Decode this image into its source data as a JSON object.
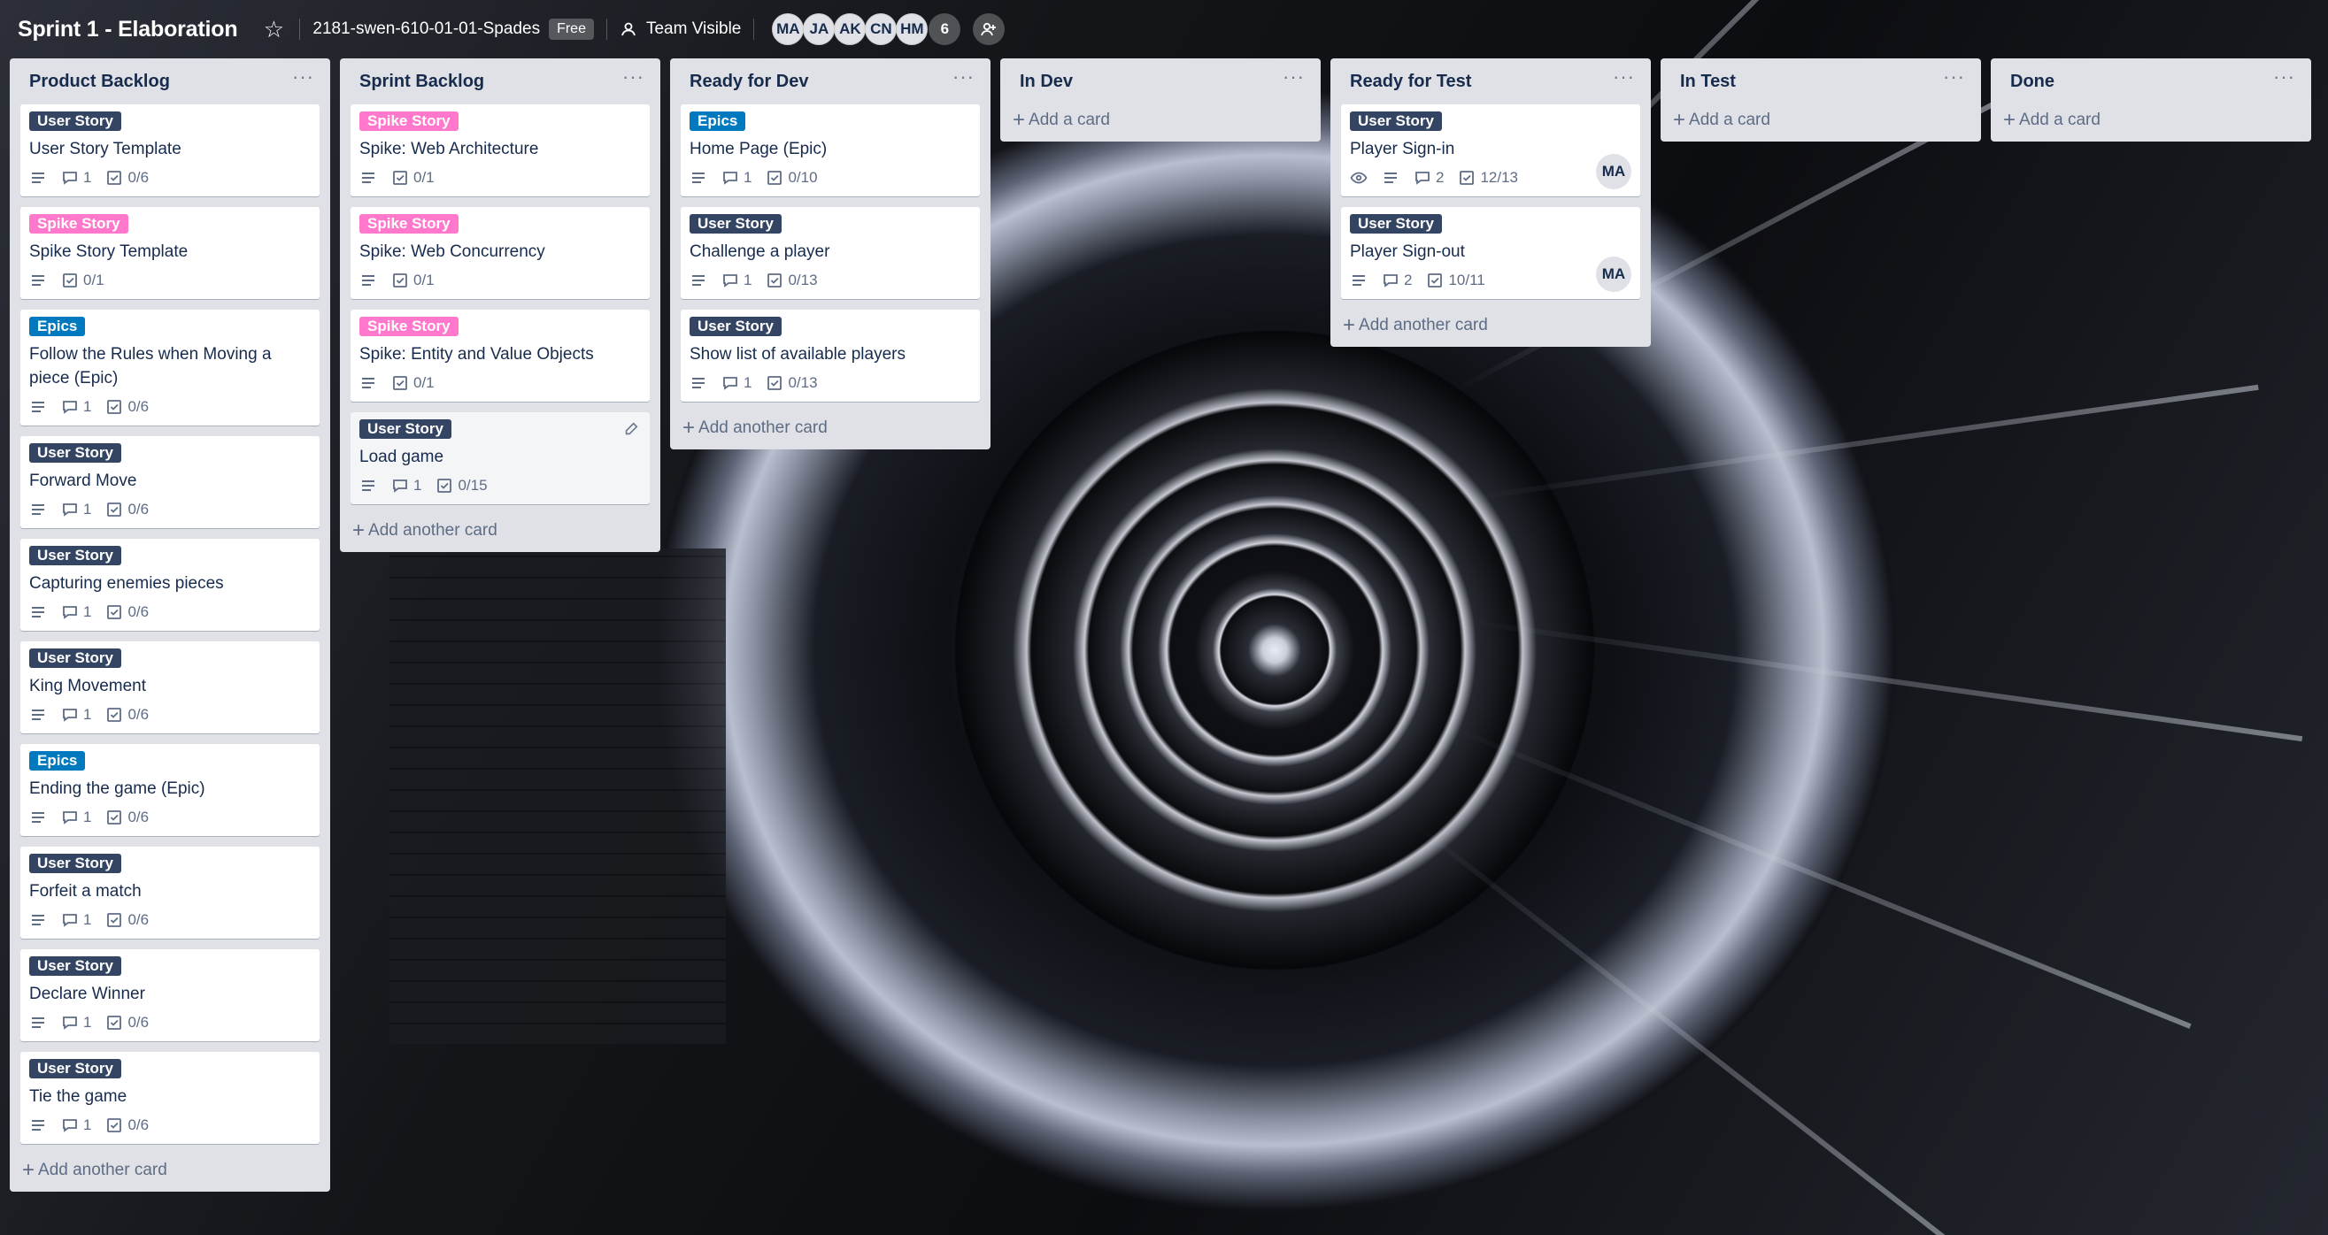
{
  "board": {
    "title": "Sprint 1 - Elaboration",
    "team": "2181-swen-610-01-01-Spades",
    "plan_badge": "Free",
    "visibility": "Team Visible",
    "members": [
      "MA",
      "JA",
      "AK",
      "CN",
      "HM"
    ],
    "more_members": "6"
  },
  "colors": {
    "user_story": "#344563",
    "spike_story": "#ff78cb",
    "epics": "#0079bf",
    "list_bg": "#dfe1e6"
  },
  "lists": [
    {
      "title": "Product Backlog",
      "add_label": "Add another card",
      "cards": [
        {
          "label": "User Story",
          "title": "User Story Template",
          "comments": "1",
          "checklist": "0/6"
        },
        {
          "label": "Spike Story",
          "title": "Spike Story Template",
          "checklist": "0/1"
        },
        {
          "label": "Epics",
          "title": "Follow the Rules when Moving a piece (Epic)",
          "comments": "1",
          "checklist": "0/6"
        },
        {
          "label": "User Story",
          "title": "Forward Move",
          "comments": "1",
          "checklist": "0/6"
        },
        {
          "label": "User Story",
          "title": "Capturing enemies pieces",
          "comments": "1",
          "checklist": "0/6"
        },
        {
          "label": "User Story",
          "title": "King Movement",
          "comments": "1",
          "checklist": "0/6"
        },
        {
          "label": "Epics",
          "title": "Ending the game (Epic)",
          "comments": "1",
          "checklist": "0/6"
        },
        {
          "label": "User Story",
          "title": "Forfeit a match",
          "comments": "1",
          "checklist": "0/6"
        },
        {
          "label": "User Story",
          "title": "Declare Winner",
          "comments": "1",
          "checklist": "0/6"
        },
        {
          "label": "User Story",
          "title": "Tie the game",
          "comments": "1",
          "checklist": "0/6"
        }
      ]
    },
    {
      "title": "Sprint Backlog",
      "add_label": "Add another card",
      "cards": [
        {
          "label": "Spike Story",
          "title": "Spike: Web Architecture",
          "checklist": "0/1"
        },
        {
          "label": "Spike Story",
          "title": "Spike: Web Concurrency",
          "checklist": "0/1"
        },
        {
          "label": "Spike Story",
          "title": "Spike: Entity and Value Objects",
          "checklist": "0/1"
        },
        {
          "label": "User Story",
          "title": "Load game",
          "comments": "1",
          "checklist": "0/15"
        }
      ]
    },
    {
      "title": "Ready for Dev",
      "add_label": "Add another card",
      "cards": [
        {
          "label": "Epics",
          "title": "Home Page (Epic)",
          "comments": "1",
          "checklist": "0/10"
        },
        {
          "label": "User Story",
          "title": "Challenge a player",
          "comments": "1",
          "checklist": "0/13"
        },
        {
          "label": "User Story",
          "title": "Show list of available players",
          "comments": "1",
          "checklist": "0/13"
        }
      ]
    },
    {
      "title": "In Dev",
      "add_label": "Add a card",
      "cards": []
    },
    {
      "title": "Ready for Test",
      "add_label": "Add another card",
      "cards": [
        {
          "label": "User Story",
          "title": "Player Sign-in",
          "comments": "2",
          "checklist": "12/13",
          "member": "MA"
        },
        {
          "label": "User Story",
          "title": "Player Sign-out",
          "comments": "2",
          "checklist": "10/11",
          "member": "MA"
        }
      ]
    },
    {
      "title": "In Test",
      "add_label": "Add a card",
      "cards": []
    },
    {
      "title": "Done",
      "add_label": "Add a card",
      "cards": []
    }
  ]
}
